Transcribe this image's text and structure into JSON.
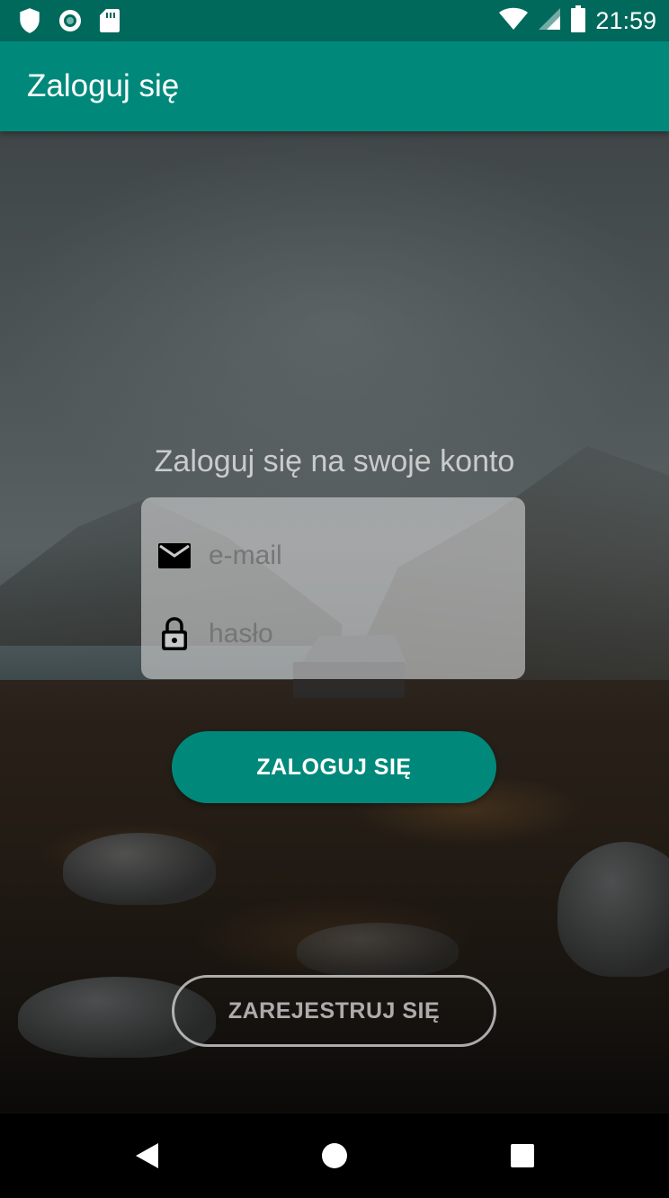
{
  "status_bar": {
    "time": "21:59",
    "icons": [
      "shield-icon",
      "sync-circle-icon",
      "sd-card-icon",
      "wifi-icon",
      "signal-icon",
      "battery-icon"
    ]
  },
  "app_bar": {
    "title": "Zaloguj się"
  },
  "login": {
    "heading": "Zaloguj się na swoje konto",
    "email_placeholder": "e-mail",
    "password_placeholder": "hasło",
    "email_icon": "envelope-icon",
    "password_icon": "lock-icon",
    "login_button": "ZALOGUJ SIĘ",
    "register_button": "ZAREJESTRUJ SIĘ"
  },
  "nav_bar": {
    "icons": [
      "back-icon",
      "home-icon",
      "recents-icon"
    ]
  },
  "colors": {
    "primary": "#00897b",
    "primary_dark": "#00695c",
    "card": "rgba(210,210,210,0.62)"
  }
}
